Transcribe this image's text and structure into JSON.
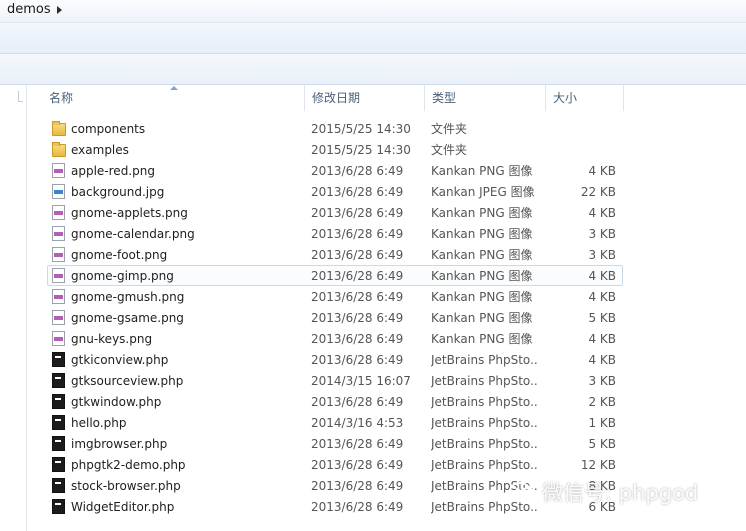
{
  "address_bar": {
    "crumb": "demos"
  },
  "columns": {
    "name": "名称",
    "date": "修改日期",
    "type": "类型",
    "size": "大小"
  },
  "files": [
    {
      "name": "components",
      "date": "2015/5/25 14:30",
      "type": "文件夹",
      "size": "",
      "icon": "folder-icon"
    },
    {
      "name": "examples",
      "date": "2015/5/25 14:30",
      "type": "文件夹",
      "size": "",
      "icon": "folder-icon"
    },
    {
      "name": "apple-red.png",
      "date": "2013/6/28 6:49",
      "type": "Kankan PNG 图像",
      "size": "4 KB",
      "icon": "png-file-icon"
    },
    {
      "name": "background.jpg",
      "date": "2013/6/28 6:49",
      "type": "Kankan JPEG 图像",
      "size": "22 KB",
      "icon": "jpg-file-icon"
    },
    {
      "name": "gnome-applets.png",
      "date": "2013/6/28 6:49",
      "type": "Kankan PNG 图像",
      "size": "4 KB",
      "icon": "png-file-icon"
    },
    {
      "name": "gnome-calendar.png",
      "date": "2013/6/28 6:49",
      "type": "Kankan PNG 图像",
      "size": "3 KB",
      "icon": "png-file-icon"
    },
    {
      "name": "gnome-foot.png",
      "date": "2013/6/28 6:49",
      "type": "Kankan PNG 图像",
      "size": "3 KB",
      "icon": "png-file-icon"
    },
    {
      "name": "gnome-gimp.png",
      "date": "2013/6/28 6:49",
      "type": "Kankan PNG 图像",
      "size": "4 KB",
      "icon": "png-file-icon",
      "hover": true
    },
    {
      "name": "gnome-gmush.png",
      "date": "2013/6/28 6:49",
      "type": "Kankan PNG 图像",
      "size": "4 KB",
      "icon": "png-file-icon"
    },
    {
      "name": "gnome-gsame.png",
      "date": "2013/6/28 6:49",
      "type": "Kankan PNG 图像",
      "size": "5 KB",
      "icon": "png-file-icon"
    },
    {
      "name": "gnu-keys.png",
      "date": "2013/6/28 6:49",
      "type": "Kankan PNG 图像",
      "size": "4 KB",
      "icon": "png-file-icon"
    },
    {
      "name": "gtkiconview.php",
      "date": "2013/6/28 6:49",
      "type": "JetBrains PhpSto...",
      "size": "4 KB",
      "icon": "php-file-icon"
    },
    {
      "name": "gtksourceview.php",
      "date": "2014/3/15 16:07",
      "type": "JetBrains PhpSto...",
      "size": "3 KB",
      "icon": "php-file-icon"
    },
    {
      "name": "gtkwindow.php",
      "date": "2013/6/28 6:49",
      "type": "JetBrains PhpSto...",
      "size": "2 KB",
      "icon": "php-file-icon"
    },
    {
      "name": "hello.php",
      "date": "2014/3/16 4:53",
      "type": "JetBrains PhpSto...",
      "size": "1 KB",
      "icon": "php-file-icon"
    },
    {
      "name": "imgbrowser.php",
      "date": "2013/6/28 6:49",
      "type": "JetBrains PhpSto...",
      "size": "5 KB",
      "icon": "php-file-icon"
    },
    {
      "name": "phpgtk2-demo.php",
      "date": "2013/6/28 6:49",
      "type": "JetBrains PhpSto...",
      "size": "12 KB",
      "icon": "php-file-icon"
    },
    {
      "name": "stock-browser.php",
      "date": "2013/6/28 6:49",
      "type": "JetBrains PhpSto...",
      "size": "8 KB",
      "icon": "php-file-icon"
    },
    {
      "name": "WidgetEditor.php",
      "date": "2013/6/28 6:49",
      "type": "JetBrains PhpSto...",
      "size": "6 KB",
      "icon": "php-file-icon"
    }
  ],
  "watermark": {
    "text": "微信号: phpgod",
    "icon": "wechat-logo-icon"
  }
}
